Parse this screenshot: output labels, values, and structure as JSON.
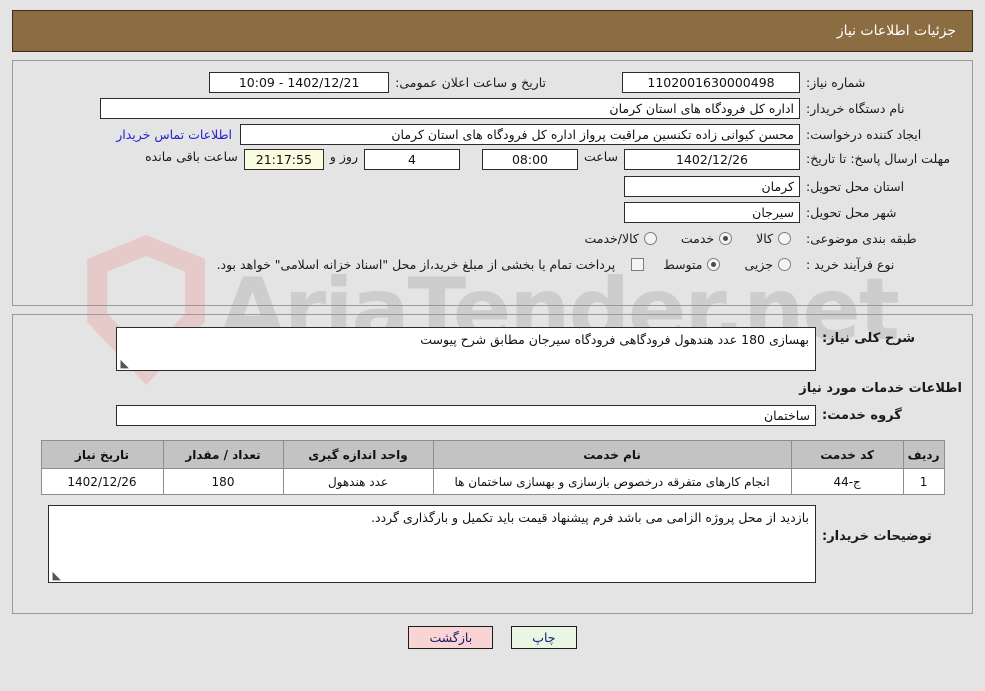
{
  "header": {
    "title": "جزئیات اطلاعات نیاز"
  },
  "top_form": {
    "need_number_label": "شماره نیاز:",
    "need_number_value": "1102001630000498",
    "announce_label": "تاریخ و ساعت اعلان عمومی:",
    "announce_value": "1402/12/21 - 10:09",
    "buyer_org_label": "نام دستگاه خریدار:",
    "buyer_org_value": "اداره کل فرودگاه های استان کرمان",
    "creator_label": "ایجاد کننده درخواست:",
    "creator_value": "محسن کیوانی زاده تکنسین مراقبت پرواز اداره کل فرودگاه های استان کرمان",
    "contact_link": "اطلاعات تماس خریدار",
    "deadline_label": "مهلت ارسال پاسخ: تا تاریخ:",
    "deadline_date": "1402/12/26",
    "hour_label": "ساعت",
    "hour_value": "08:00",
    "days_value": "4",
    "days_suffix": "روز و",
    "countdown_value": "21:17:55",
    "countdown_suffix": "ساعت باقی مانده",
    "province_label": "استان محل تحویل:",
    "province_value": "کرمان",
    "city_label": "شهر محل تحویل:",
    "city_value": "سیرجان",
    "category_label": "طبقه بندی موضوعی:",
    "category_options": [
      {
        "label": "کالا",
        "selected": false
      },
      {
        "label": "خدمت",
        "selected": true
      },
      {
        "label": "کالا/خدمت",
        "selected": false
      }
    ],
    "process_label": "نوع فرآیند خرید :",
    "process_options": [
      {
        "label": "جزیی",
        "selected": false
      },
      {
        "label": "متوسط",
        "selected": true
      }
    ],
    "treasury_checkbox_checked": false,
    "treasury_note": "پرداخت تمام یا بخشی از مبلغ خرید،از محل \"اسناد خزانه اسلامی\" خواهد بود."
  },
  "description": {
    "label": "شرح کلی نیاز:",
    "value": "بهسازی 180 عدد هندهول فرودگاهی فرودگاه سیرجان مطابق شرح پیوست"
  },
  "services_section": {
    "title": "اطلاعات خدمات مورد نیاز",
    "group_label": "گروه خدمت:",
    "group_value": "ساختمان"
  },
  "items_table": {
    "columns": [
      "ردیف",
      "کد خدمت",
      "نام خدمت",
      "واحد اندازه گیری",
      "تعداد / مقدار",
      "تاریخ نیاز"
    ],
    "rows": [
      {
        "row": "1",
        "code": "ج-44",
        "name": "انجام کارهای متفرقه درخصوص بازسازی و بهسازی ساختمان ها",
        "unit": "عدد هندهول",
        "qty": "180",
        "date": "1402/12/26"
      }
    ]
  },
  "buyer_notes": {
    "label": "توضیحات خریدار:",
    "value": "بازدید از محل پروژه الزامی می باشد فرم پیشنهاد قیمت باید تکمیل و بارگذاری گردد."
  },
  "footer": {
    "back_label": "بازگشت",
    "print_label": "چاپ"
  },
  "watermark": {
    "text": "AriaTender.net"
  }
}
